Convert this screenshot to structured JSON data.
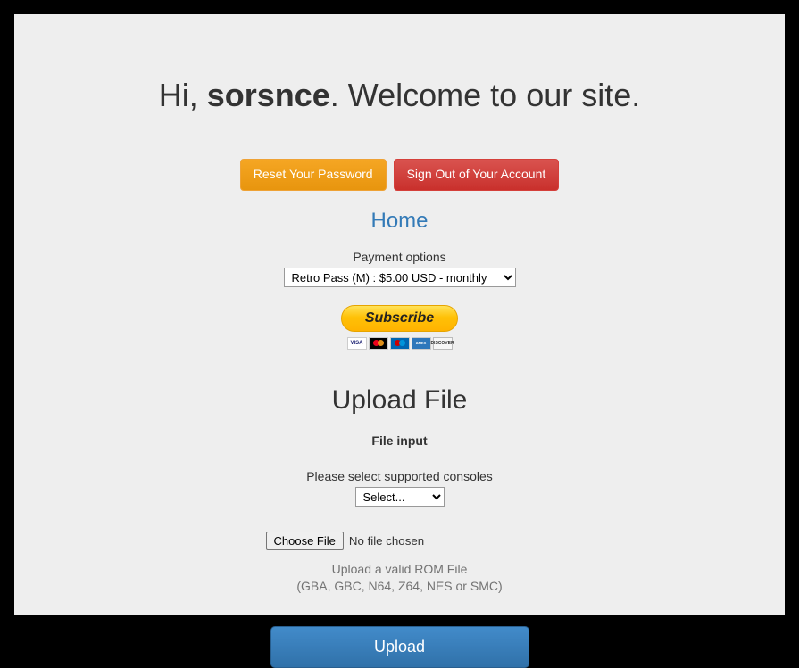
{
  "greeting": {
    "prefix": "Hi, ",
    "username": "sorsnce",
    "suffix": ". Welcome to our site."
  },
  "buttons": {
    "reset_password": "Reset Your Password",
    "sign_out": "Sign Out of Your Account"
  },
  "home_link": "Home",
  "payment": {
    "label": "Payment options",
    "selected": "Retro Pass (M) : $5.00 USD - monthly",
    "subscribe_label": "Subscribe"
  },
  "upload": {
    "heading": "Upload File",
    "file_input_label": "File input",
    "console_label": "Please select supported consoles",
    "console_selected": "Select...",
    "choose_file_label": "Choose File",
    "file_status": "No file chosen",
    "help_line1": "Upload a valid ROM File",
    "help_line2": "(GBA, GBC, N64, Z64, NES or SMC)",
    "submit_label": "Upload"
  },
  "cards": {
    "visa": "VISA",
    "amex": "AMEX",
    "disc": "DISCOVER"
  }
}
